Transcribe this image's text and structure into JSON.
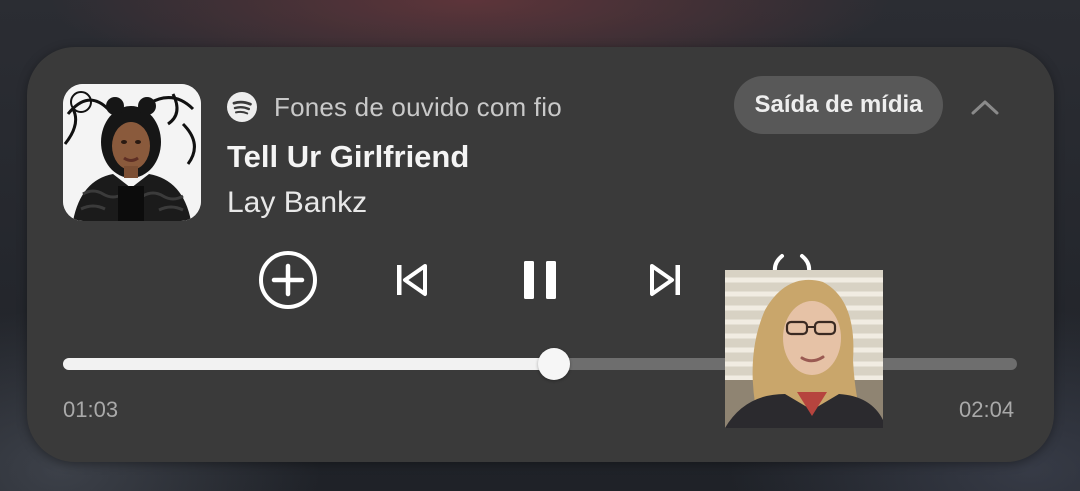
{
  "player": {
    "source_label": "Fones de ouvido com fio",
    "output_button_label": "Saída de mídia",
    "track_title": "Tell Ur Girlfriend",
    "track_artist": "Lay Bankz",
    "time_elapsed": "01:03",
    "time_total": "02:04",
    "progress_fraction": 0.515,
    "app_icon": "spotify-icon",
    "controls": [
      "add-icon",
      "previous-icon",
      "pause-icon",
      "next-icon",
      "broadcast-icon"
    ],
    "accent_color": "#ffffff",
    "card_color": "#3a3a3a",
    "track_color": "#6e6e6e"
  }
}
